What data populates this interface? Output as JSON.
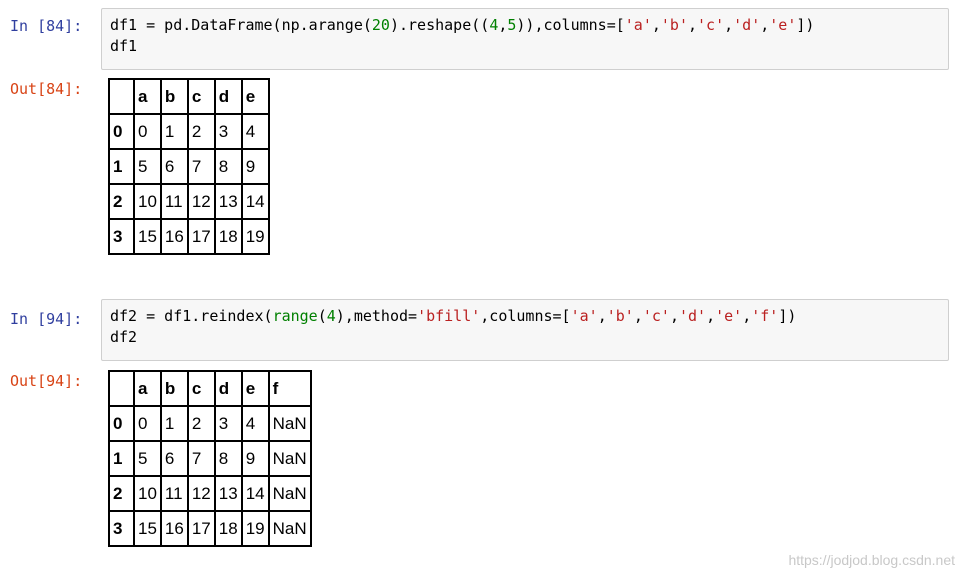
{
  "cells": [
    {
      "in_prompt": "In [84]:",
      "out_prompt": "Out[84]:",
      "code_line1": [
        {
          "t": "df1 = pd.DataFrame(np.arange(",
          "c": ""
        },
        {
          "t": "20",
          "c": "num"
        },
        {
          "t": ").reshape((",
          "c": ""
        },
        {
          "t": "4",
          "c": "num"
        },
        {
          "t": ",",
          "c": ""
        },
        {
          "t": "5",
          "c": "num"
        },
        {
          "t": ")),columns=[",
          "c": ""
        },
        {
          "t": "'a'",
          "c": "str"
        },
        {
          "t": ",",
          "c": ""
        },
        {
          "t": "'b'",
          "c": "str"
        },
        {
          "t": ",",
          "c": ""
        },
        {
          "t": "'c'",
          "c": "str"
        },
        {
          "t": ",",
          "c": ""
        },
        {
          "t": "'d'",
          "c": "str"
        },
        {
          "t": ",",
          "c": ""
        },
        {
          "t": "'e'",
          "c": "str"
        },
        {
          "t": "])",
          "c": ""
        }
      ],
      "code_line2": "df1",
      "table": {
        "columns": [
          "a",
          "b",
          "c",
          "d",
          "e"
        ],
        "rows": [
          {
            "index": "0",
            "values": [
              "0",
              "1",
              "2",
              "3",
              "4"
            ]
          },
          {
            "index": "1",
            "values": [
              "5",
              "6",
              "7",
              "8",
              "9"
            ]
          },
          {
            "index": "2",
            "values": [
              "10",
              "11",
              "12",
              "13",
              "14"
            ]
          },
          {
            "index": "3",
            "values": [
              "15",
              "16",
              "17",
              "18",
              "19"
            ]
          }
        ]
      }
    },
    {
      "in_prompt": "In [94]:",
      "out_prompt": "Out[94]:",
      "code_line1": [
        {
          "t": "df2 = df1.reindex(",
          "c": ""
        },
        {
          "t": "range",
          "c": "bi"
        },
        {
          "t": "(",
          "c": ""
        },
        {
          "t": "4",
          "c": "num"
        },
        {
          "t": "),method=",
          "c": ""
        },
        {
          "t": "'bfill'",
          "c": "str"
        },
        {
          "t": ",columns=[",
          "c": ""
        },
        {
          "t": "'a'",
          "c": "str"
        },
        {
          "t": ",",
          "c": ""
        },
        {
          "t": "'b'",
          "c": "str"
        },
        {
          "t": ",",
          "c": ""
        },
        {
          "t": "'c'",
          "c": "str"
        },
        {
          "t": ",",
          "c": ""
        },
        {
          "t": "'d'",
          "c": "str"
        },
        {
          "t": ",",
          "c": ""
        },
        {
          "t": "'e'",
          "c": "str"
        },
        {
          "t": ",",
          "c": ""
        },
        {
          "t": "'f'",
          "c": "str"
        },
        {
          "t": "])",
          "c": ""
        }
      ],
      "code_line2": "df2",
      "table": {
        "columns": [
          "a",
          "b",
          "c",
          "d",
          "e",
          "f"
        ],
        "rows": [
          {
            "index": "0",
            "values": [
              "0",
              "1",
              "2",
              "3",
              "4",
              "NaN"
            ]
          },
          {
            "index": "1",
            "values": [
              "5",
              "6",
              "7",
              "8",
              "9",
              "NaN"
            ]
          },
          {
            "index": "2",
            "values": [
              "10",
              "11",
              "12",
              "13",
              "14",
              "NaN"
            ]
          },
          {
            "index": "3",
            "values": [
              "15",
              "16",
              "17",
              "18",
              "19",
              "NaN"
            ]
          }
        ]
      }
    }
  ],
  "watermark": "https://jodjod.blog.csdn.net",
  "colors": {
    "in_prompt": "#303F9F",
    "out_prompt": "#D84315",
    "number": "#008000",
    "string": "#BA2121",
    "builtin": "#008000",
    "input_bg": "#f7f7f7"
  }
}
